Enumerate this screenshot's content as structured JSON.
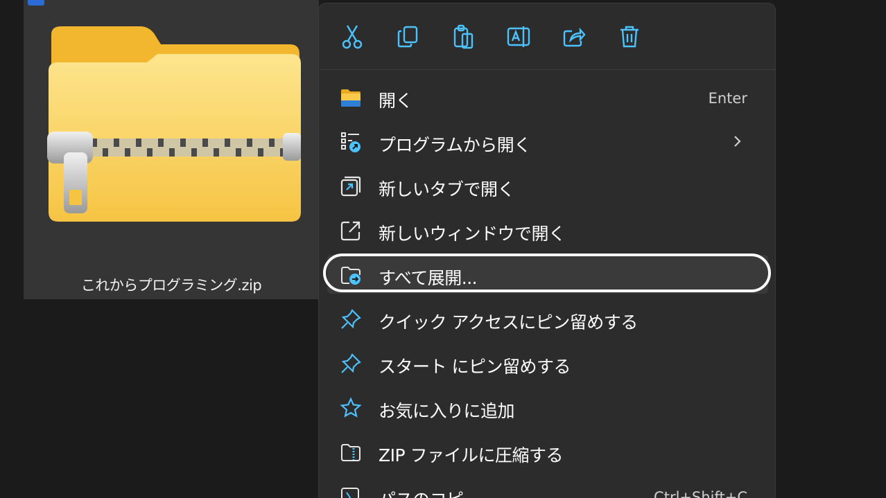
{
  "file": {
    "name": "これからプログラミング.zip"
  },
  "toolbar": {
    "cut_icon": "scissors-icon",
    "copy_icon": "copy-icon",
    "paste_icon": "paste-icon",
    "rename_icon": "rename-icon",
    "share_icon": "share-icon",
    "delete_icon": "trash-icon"
  },
  "menu": {
    "items": [
      {
        "label": "開く",
        "shortcut": "Enter",
        "icon": "folder-icon"
      },
      {
        "label": "プログラムから開く",
        "shortcut": "",
        "icon": "open-with-icon",
        "submenu": true
      },
      {
        "label": "新しいタブで開く",
        "shortcut": "",
        "icon": "new-tab-icon"
      },
      {
        "label": "新しいウィンドウで開く",
        "shortcut": "",
        "icon": "new-window-icon"
      },
      {
        "label": "すべて展開...",
        "shortcut": "",
        "icon": "extract-icon"
      },
      {
        "label": "クイック アクセスにピン留めする",
        "shortcut": "",
        "icon": "pin-icon"
      },
      {
        "label": "スタート にピン留めする",
        "shortcut": "",
        "icon": "pin-icon"
      },
      {
        "label": "お気に入りに追加",
        "shortcut": "",
        "icon": "star-icon"
      },
      {
        "label": "ZIP ファイルに圧縮する",
        "shortcut": "",
        "icon": "zip-compress-icon"
      },
      {
        "label": "パスのコピー",
        "shortcut": "Ctrl+Shift+C",
        "icon": "copy-path-icon"
      }
    ]
  },
  "colors": {
    "menu_background": "#2c2c2c",
    "highlight_row": "#3a3a3a",
    "accent_blue": "#4cc2ff",
    "folder_yellow": "#f8c94b"
  }
}
